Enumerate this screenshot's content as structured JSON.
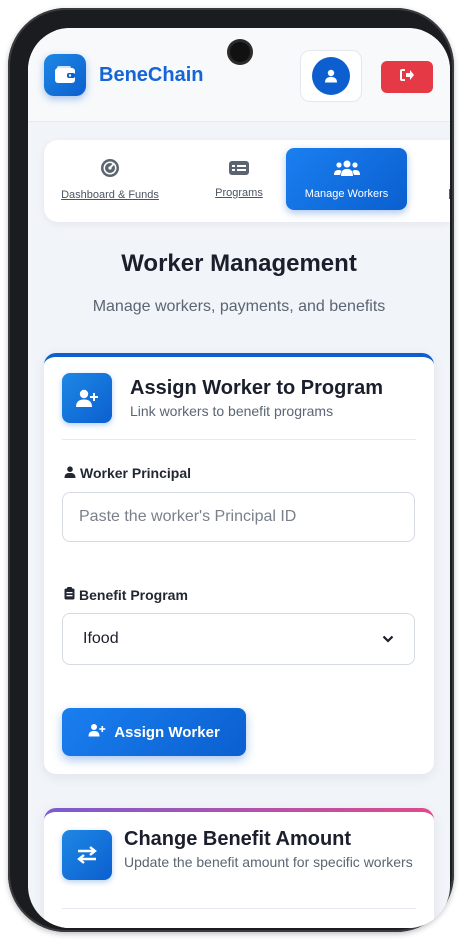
{
  "header": {
    "brand": "BeneChain",
    "logo_icon": "wallet-icon",
    "user_icon": "user-icon",
    "logout_icon": "logout-icon",
    "brand_color": "#1565d8",
    "logout_color": "#e53946"
  },
  "nav": {
    "items": [
      {
        "label": "Dashboard & Funds",
        "icon": "dashboard-gauge-icon"
      },
      {
        "label": "Programs",
        "icon": "id-card-icon"
      },
      {
        "label": "Manage Workers",
        "icon": "users-icon",
        "active": true
      }
    ]
  },
  "page": {
    "title": "Worker Management",
    "subtitle": "Manage workers, payments, and benefits"
  },
  "assign_card": {
    "title": "Assign Worker to Program",
    "subtitle": "Link workers to benefit programs",
    "principal_label": "Worker Principal",
    "principal_placeholder": "Paste the worker's Principal ID",
    "program_label": "Benefit Program",
    "program_selected": "Ifood",
    "button_label": "Assign Worker"
  },
  "change_card": {
    "title": "Change Benefit Amount",
    "subtitle": "Update the benefit amount for specific workers"
  }
}
